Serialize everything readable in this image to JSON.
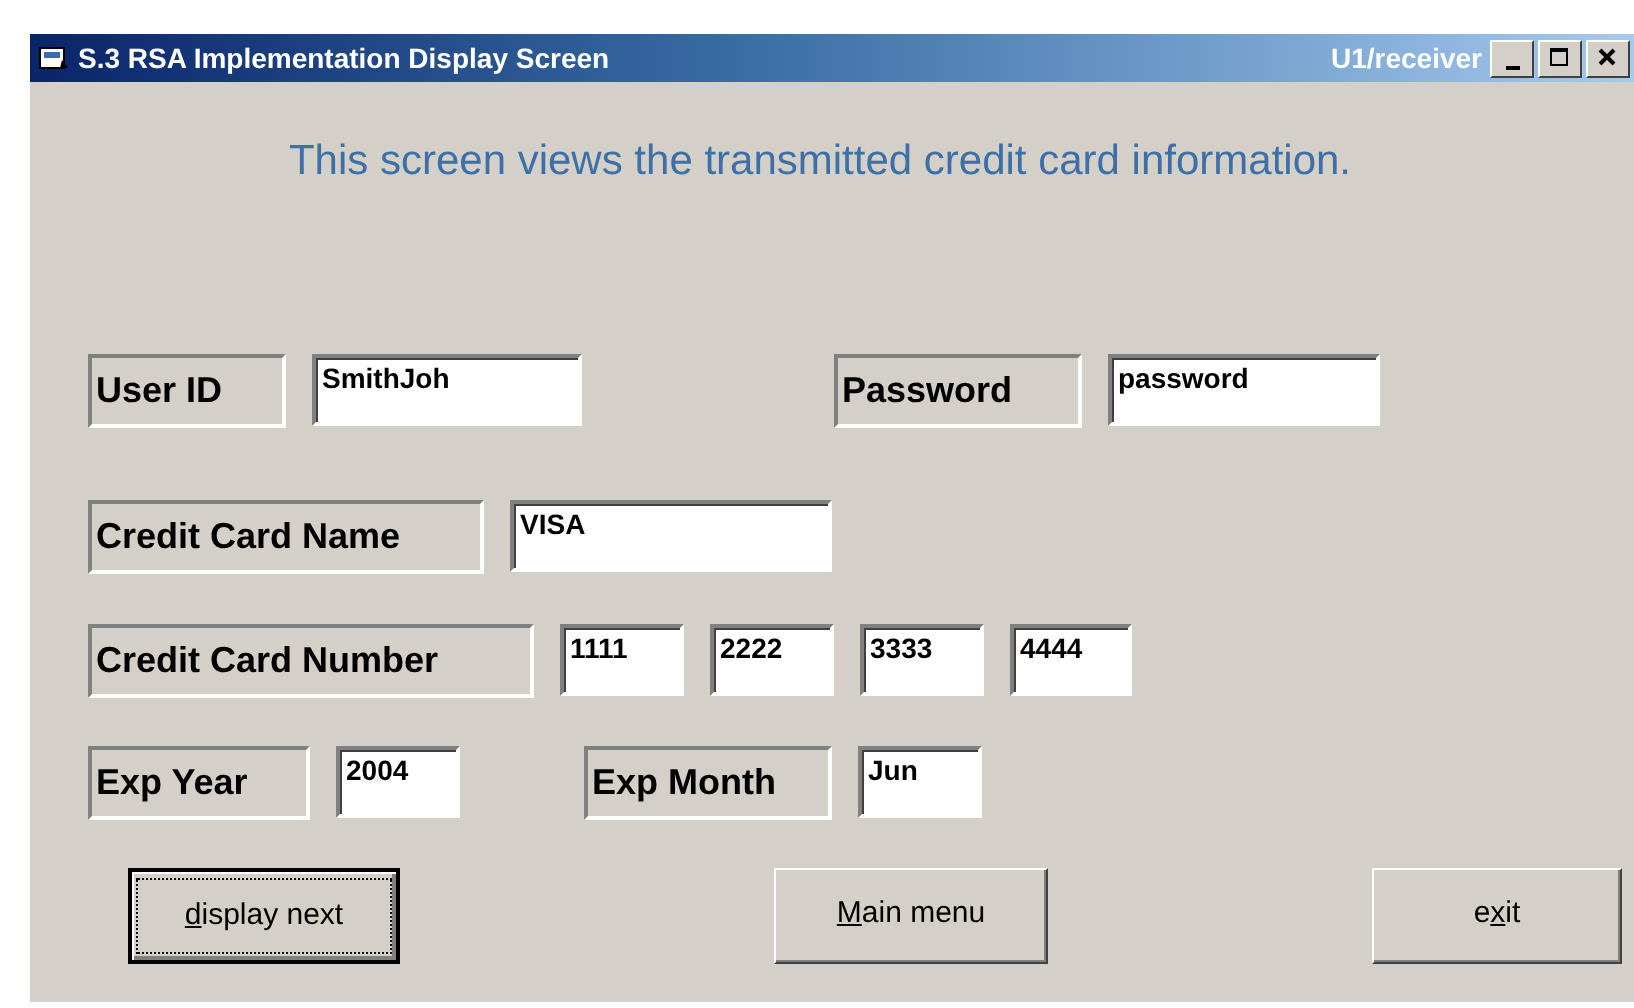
{
  "window": {
    "title": "S.3 RSA Implementation Display Screen",
    "user": "U1/receiver"
  },
  "heading": "This screen views the transmitted credit card information.",
  "rows": [
    {
      "fields": [
        {
          "label": "User ID",
          "values": [
            "SmithJoh"
          ]
        },
        {
          "label": "Password",
          "values": [
            "password"
          ]
        }
      ]
    },
    {
      "fields": [
        {
          "label": "Credit Card Name",
          "values": [
            "VISA"
          ]
        }
      ]
    },
    {
      "fields": [
        {
          "label": "Credit Card Number",
          "values": [
            "1111",
            "2222",
            "3333",
            "4444"
          ]
        }
      ]
    },
    {
      "fields": [
        {
          "label": "Exp Year",
          "values": [
            "2004"
          ]
        },
        {
          "label": "Exp Month",
          "values": [
            "Jun"
          ]
        }
      ]
    }
  ],
  "buttons": [
    {
      "access_key": "d",
      "label_end": "isplay next",
      "default": true
    },
    {
      "access_key": "M",
      "label_end": "ain menu",
      "default": false
    },
    {
      "label_start": "e",
      "access_key": "x",
      "label_end": "it",
      "default": false
    }
  ]
}
